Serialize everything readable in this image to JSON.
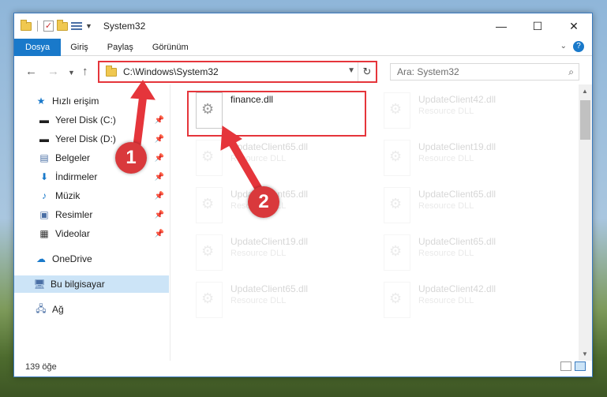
{
  "window": {
    "title": "System32"
  },
  "ribbon": {
    "tabs": [
      "Dosya",
      "Giriş",
      "Paylaş",
      "Görünüm"
    ]
  },
  "address": {
    "path": "C:\\Windows\\System32"
  },
  "search": {
    "placeholder": "Ara: System32"
  },
  "sidebar": {
    "items": [
      {
        "label": "Hızlı erişim"
      },
      {
        "label": "Yerel Disk (C:)"
      },
      {
        "label": "Yerel Disk (D:)"
      },
      {
        "label": "Belgeler"
      },
      {
        "label": "İndirmeler"
      },
      {
        "label": "Müzik"
      },
      {
        "label": "Resimler"
      },
      {
        "label": "Videolar"
      },
      {
        "label": "OneDrive"
      },
      {
        "label": "Bu bilgisayar"
      },
      {
        "label": "Ağ"
      }
    ]
  },
  "files": [
    {
      "name": "finance.dll",
      "type": ""
    },
    {
      "name": "UpdateClient42.dll",
      "type": "Resource DLL"
    },
    {
      "name": "UpdateClient65.dll",
      "type": "Resource DLL"
    },
    {
      "name": "UpdateClient19.dll",
      "type": "Resource DLL"
    },
    {
      "name": "UpdateClient65.dll",
      "type": "Resource DLL"
    },
    {
      "name": "UpdateClient65.dll",
      "type": "Resource DLL"
    },
    {
      "name": "UpdateClient19.dll",
      "type": "Resource DLL"
    },
    {
      "name": "UpdateClient65.dll",
      "type": "Resource DLL"
    },
    {
      "name": "UpdateClient65.dll",
      "type": "Resource DLL"
    },
    {
      "name": "UpdateClient42.dll",
      "type": "Resource DLL"
    }
  ],
  "status": {
    "count": "139 öğe"
  },
  "annotations": {
    "step1": "1",
    "step2": "2"
  },
  "colors": {
    "accent": "#1979ca",
    "highlight": "#e5353b",
    "selection": "#cce4f7"
  }
}
